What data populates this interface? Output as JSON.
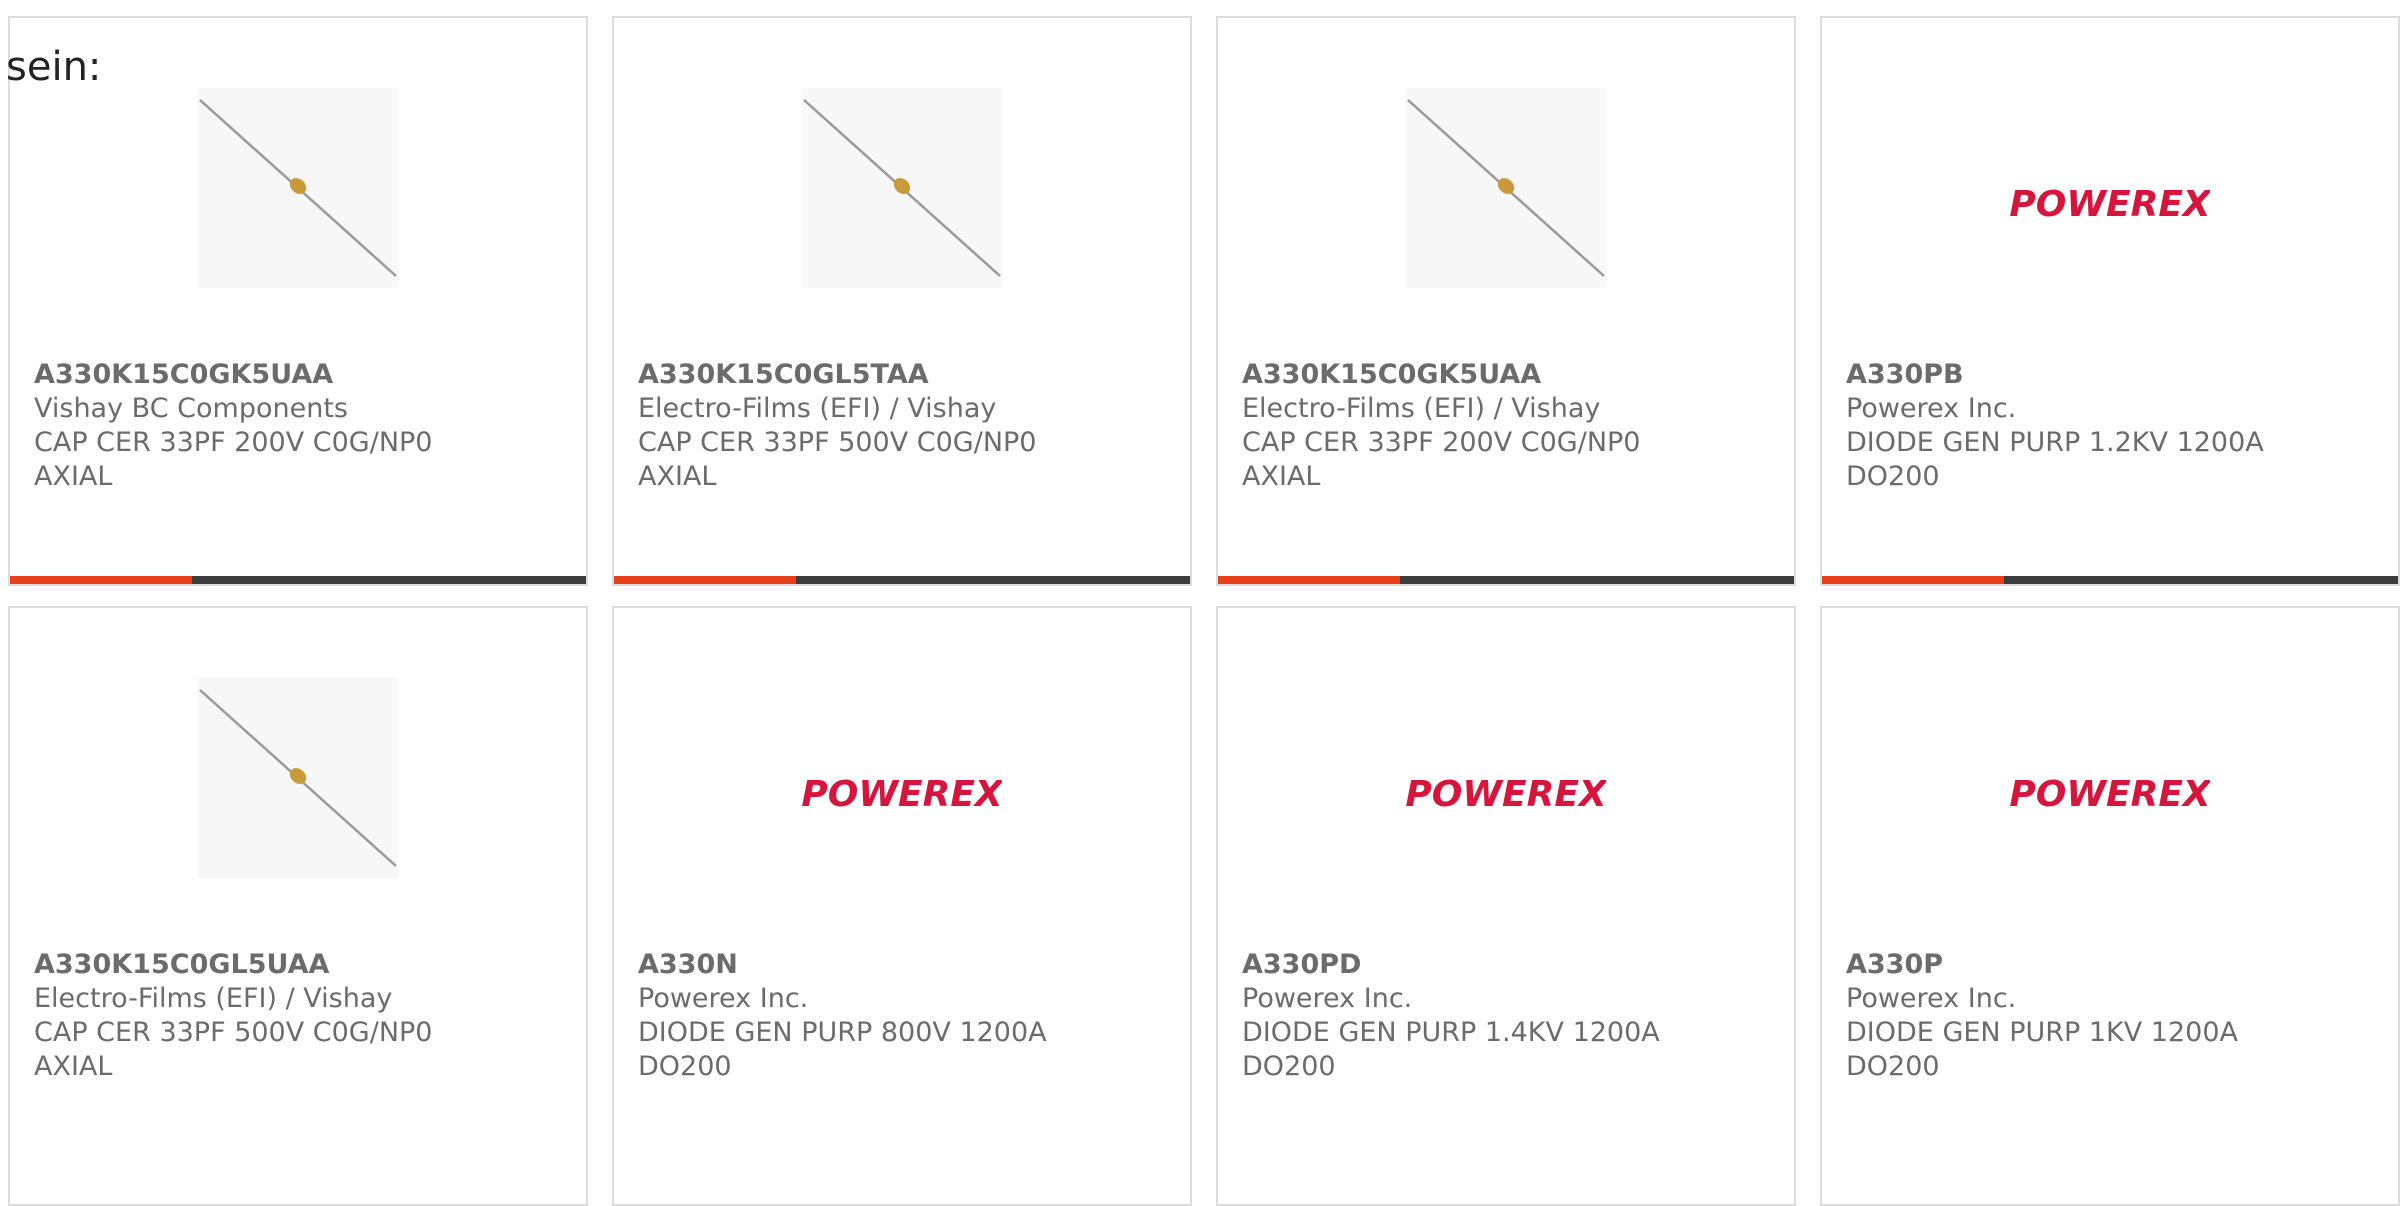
{
  "intro_text": "sein:",
  "cards": [
    {
      "part": "A330K15C0GK5UAA",
      "maker": "Vishay BC Components",
      "desc1": "CAP CER 33PF 200V C0G/NP0",
      "desc2": "AXIAL",
      "image": "capacitor-image"
    },
    {
      "part": "A330K15C0GL5TAA",
      "maker": "Electro-Films (EFI) / Vishay",
      "desc1": "CAP CER 33PF 500V C0G/NP0",
      "desc2": "AXIAL",
      "image": "capacitor-image"
    },
    {
      "part": "A330K15C0GK5UAA",
      "maker": "Electro-Films (EFI) / Vishay",
      "desc1": "CAP CER 33PF 200V C0G/NP0",
      "desc2": "AXIAL",
      "image": "capacitor-image"
    },
    {
      "part": "A330PB",
      "maker": "Powerex Inc.",
      "desc1": "DIODE GEN PURP 1.2KV 1200A",
      "desc2": "DO200",
      "image": "powerex-logo",
      "logo_text": "POWEREX"
    },
    {
      "part": "A330K15C0GL5UAA",
      "maker": "Electro-Films (EFI) / Vishay",
      "desc1": "CAP CER 33PF 500V C0G/NP0",
      "desc2": "AXIAL",
      "image": "capacitor-image"
    },
    {
      "part": "A330N",
      "maker": "Powerex Inc.",
      "desc1": "DIODE GEN PURP 800V 1200A",
      "desc2": "DO200",
      "image": "powerex-logo",
      "logo_text": "POWEREX"
    },
    {
      "part": "A330PD",
      "maker": "Powerex Inc.",
      "desc1": "DIODE GEN PURP 1.4KV 1200A",
      "desc2": "DO200",
      "image": "powerex-logo",
      "logo_text": "POWEREX"
    },
    {
      "part": "A330P",
      "maker": "Powerex Inc.",
      "desc1": "DIODE GEN PURP 1KV 1200A",
      "desc2": "DO200",
      "image": "powerex-logo",
      "logo_text": "POWEREX"
    }
  ],
  "colors": {
    "accent": "#e8401c",
    "bar": "#3c3c3c",
    "logo_red": "#d7143c",
    "text": "#6b6b6b"
  }
}
